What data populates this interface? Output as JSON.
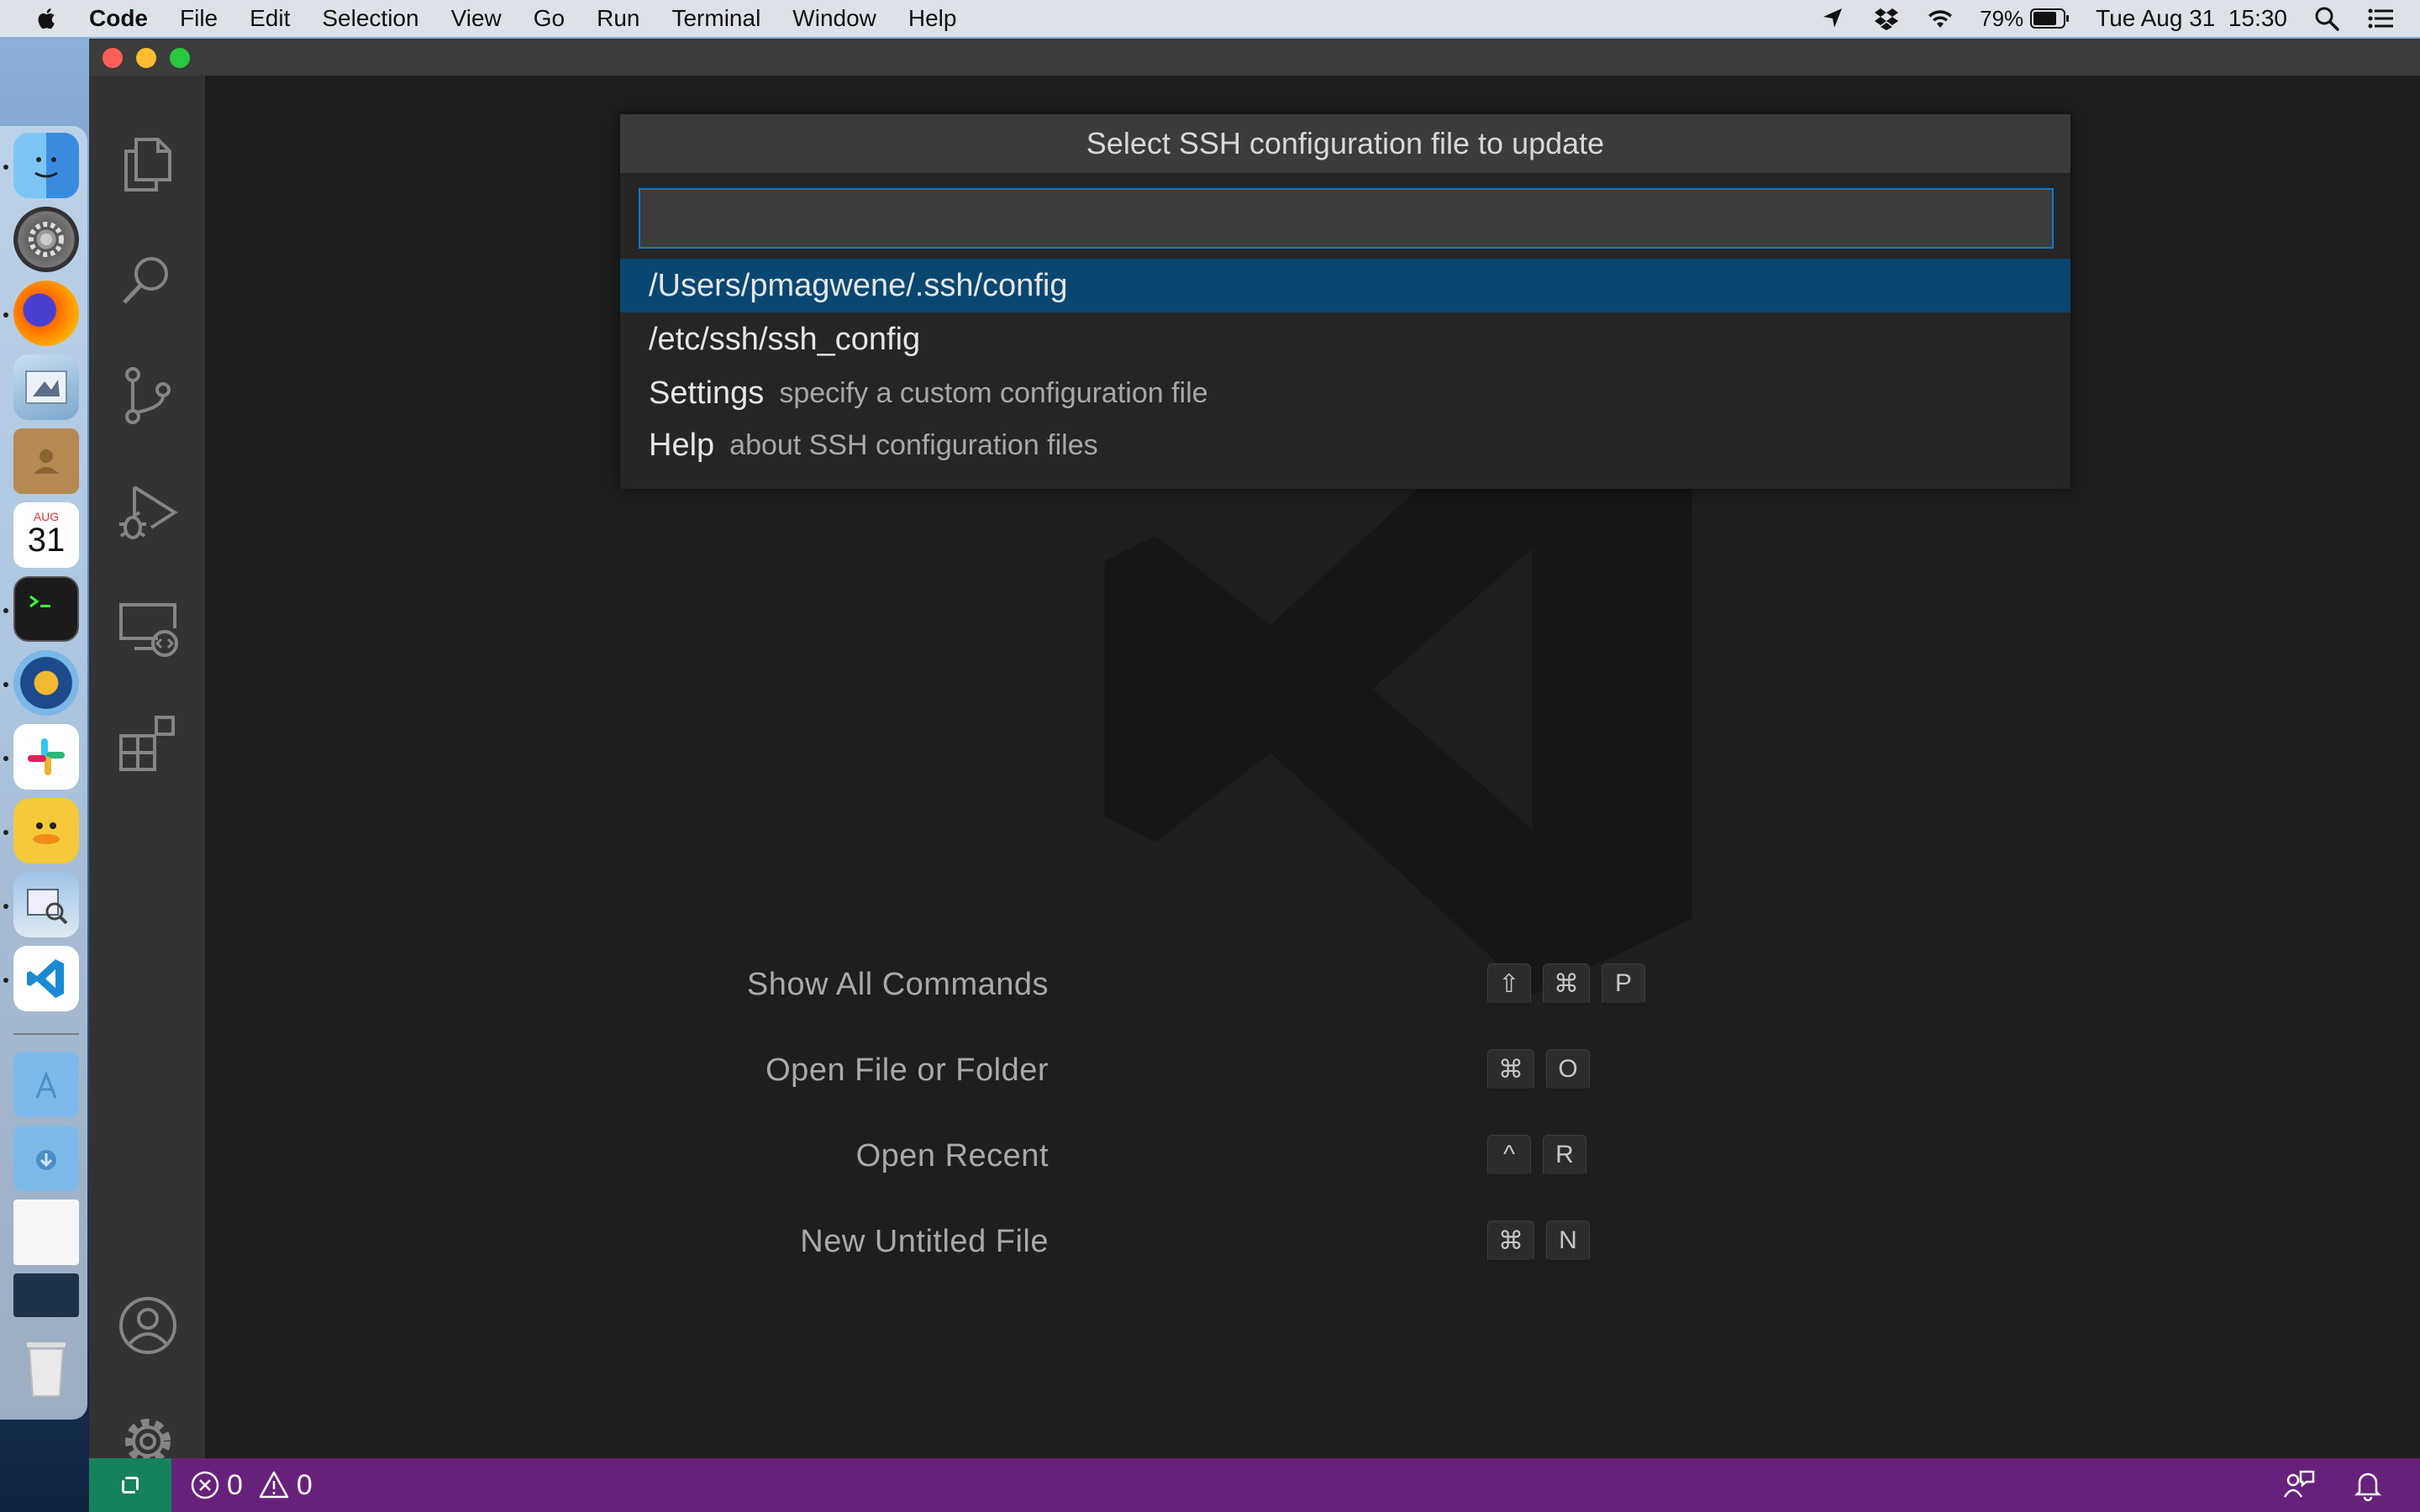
{
  "menubar": {
    "items": [
      "Code",
      "File",
      "Edit",
      "Selection",
      "View",
      "Go",
      "Run",
      "Terminal",
      "Window",
      "Help"
    ],
    "battery": "79%",
    "clock": "Tue Aug 31  15:30",
    "icons": [
      "apple-icon",
      "location-arrow-icon",
      "dropbox-icon",
      "wifi-icon",
      "battery-icon",
      "spotlight-search-icon",
      "control-center-icon"
    ]
  },
  "dock": {
    "apps": [
      "finder",
      "system-preferences",
      "firefox",
      "mail",
      "contacts",
      "calendar",
      "terminal",
      "ssh-app",
      "slack",
      "cyberduck",
      "preview",
      "vscode",
      "applications-folder",
      "downloads-folder",
      "document-thumbnail",
      "terminal-thumbnail",
      "trash"
    ],
    "calendar_month": "AUG",
    "calendar_day": "31"
  },
  "activity_bar": {
    "top_icons": [
      "explorer-icon",
      "search-icon",
      "source-control-icon",
      "run-debug-icon",
      "remote-explorer-icon",
      "extensions-icon"
    ],
    "bottom_icons": [
      "accounts-icon",
      "manage-gear-icon"
    ]
  },
  "quick_pick": {
    "title": "Select SSH configuration file to update",
    "input_value": "",
    "items": [
      {
        "label": "/Users/pmagwene/.ssh/config",
        "description": "",
        "selected": true
      },
      {
        "label": "/etc/ssh/ssh_config",
        "description": "",
        "selected": false
      },
      {
        "label": "Settings",
        "description": "specify a custom configuration file",
        "selected": false
      },
      {
        "label": "Help",
        "description": "about SSH configuration files",
        "selected": false
      }
    ]
  },
  "shortcuts": [
    {
      "label": "Show All Commands",
      "keys": [
        "⇧",
        "⌘",
        "P"
      ]
    },
    {
      "label": "Open File or Folder",
      "keys": [
        "⌘",
        "O"
      ]
    },
    {
      "label": "Open Recent",
      "keys": [
        "^",
        "R"
      ]
    },
    {
      "label": "New Untitled File",
      "keys": [
        "⌘",
        "N"
      ]
    }
  ],
  "statusbar": {
    "errors": "0",
    "warnings": "0",
    "colors": {
      "background": "#68217a",
      "remote": "#16825d"
    }
  },
  "colors": {
    "selection": "#094771",
    "input_border": "#0e7ad3",
    "editor_bg": "#1e1e1e",
    "activity_bg": "#333333"
  }
}
